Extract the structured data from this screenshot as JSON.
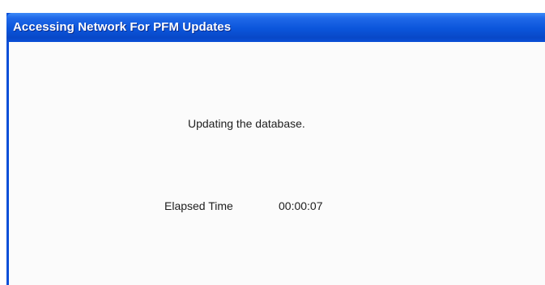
{
  "window": {
    "title": "Accessing Network For PFM Updates"
  },
  "status": {
    "message": "Updating the database."
  },
  "elapsed": {
    "label": "Elapsed Time",
    "value": "00:00:07"
  },
  "colors": {
    "titlebar": "#0b55db",
    "frame": "#0a4fd8",
    "client_background": "#fbfbfb",
    "text": "#1e1e1e"
  }
}
